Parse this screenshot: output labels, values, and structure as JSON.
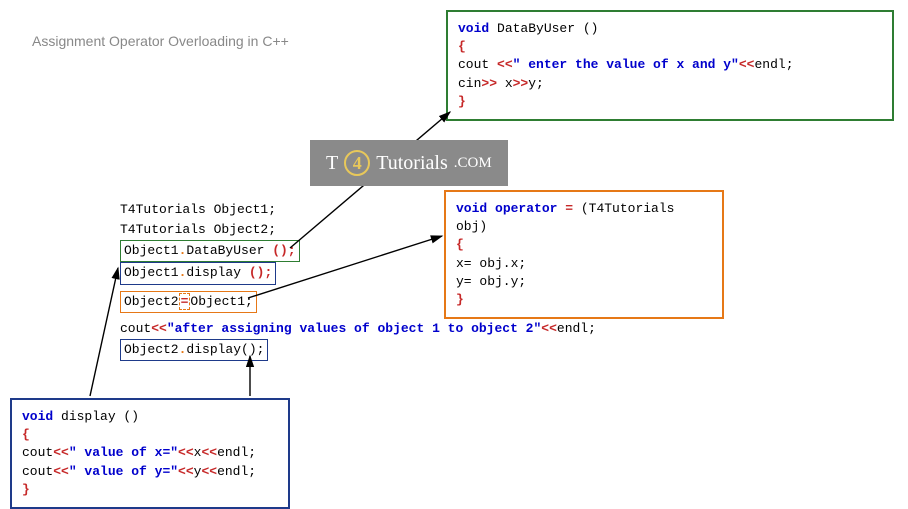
{
  "title": "Assignment Operator Overloading in C++",
  "dataByUser": {
    "sig_void": "void",
    "sig_name": " DataByUser ()",
    "open": "{",
    "l1a": " cout ",
    "l1b": "<<",
    "l1c": "\" enter the value of x and y\"",
    "l1d": "<<",
    "l1e": "endl",
    "l1f": ";",
    "l2a": " cin",
    "l2b": ">> ",
    "l2c": "x",
    "l2d": ">>",
    "l2e": "y;",
    "close": " }"
  },
  "operatorFn": {
    "sig_void": "void",
    "sig_op": " operator ",
    "sig_eq": "=",
    "sig_rest": " (T4Tutorials obj)",
    "open": " {",
    "l1": "  x= obj.x;",
    "l2": "  y= obj.y;",
    "close": "  }"
  },
  "main": {
    "l1": "T4Tutorials Object1;",
    "l2": "T4Tutorials Object2;",
    "l3a": "Object1",
    "l3b": ".",
    "l3c": "DataByUser ",
    "l3d": "();",
    "l4a": "Object1",
    "l4b": ".",
    "l4c": "display ",
    "l4d": "();",
    "l5a": "Object2",
    "l5b": "=",
    "l5c": "Object1;",
    "l6a": "cout",
    "l6b": "<<",
    "l6c": "\"after assigning values of object 1 to object 2\"",
    "l6d": "<<",
    "l6e": "endl;",
    "l7a": "Object2",
    "l7b": ".",
    "l7c": "display();"
  },
  "display": {
    "sig_void": "void",
    "sig_name": " display ()",
    "open": " {",
    "l1a": "cout",
    "l1b": "<<",
    "l1c": "\" value of x=\"",
    "l1d": "<<",
    "l1e": "x",
    "l1f": "<<",
    "l1g": "endl;",
    "l2a": "cout",
    "l2b": "<<",
    "l2c": "\" value of y=\"",
    "l2d": "<<",
    "l2e": "y",
    "l2f": "<<",
    "l2g": "endl;",
    "close": " }"
  },
  "watermark": {
    "t": "T",
    "four": "4",
    "rest": "Tutorials",
    "dot": " .COM"
  }
}
